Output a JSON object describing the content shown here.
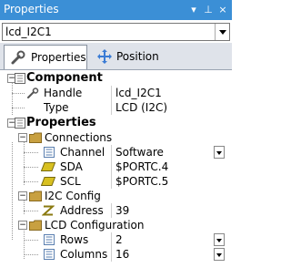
{
  "window": {
    "title": "Properties",
    "buttons": {
      "menu": "▾",
      "pin": "⊥",
      "close": "×"
    }
  },
  "selector": {
    "value": "lcd_I2C1"
  },
  "tabs": [
    {
      "label": "Properties",
      "icon": "wrench-icon"
    },
    {
      "label": "Position",
      "icon": "move-arrows-icon"
    }
  ],
  "grid": {
    "component": {
      "label": "Component",
      "items": [
        {
          "name": "Handle",
          "value": "lcd_I2C1"
        },
        {
          "name": "Type",
          "value": "LCD (I2C)"
        }
      ]
    },
    "properties": {
      "label": "Properties",
      "connections": {
        "label": "Connections",
        "items": [
          {
            "name": "Channel",
            "value": "Software"
          },
          {
            "name": "SDA",
            "value": "$PORTC.4"
          },
          {
            "name": "SCL",
            "value": "$PORTC.5"
          }
        ]
      },
      "i2c_config": {
        "label": "I2C Config",
        "items": [
          {
            "name": "Address",
            "value": "39"
          }
        ]
      },
      "lcd_config": {
        "label": "LCD Configuration",
        "items": [
          {
            "name": "Rows",
            "value": "2"
          },
          {
            "name": "Columns",
            "value": "16"
          }
        ]
      }
    }
  },
  "colors": {
    "titlebar": "#3b8fd6",
    "folder": "#c8a040",
    "pin_icon": "#d8c020"
  }
}
